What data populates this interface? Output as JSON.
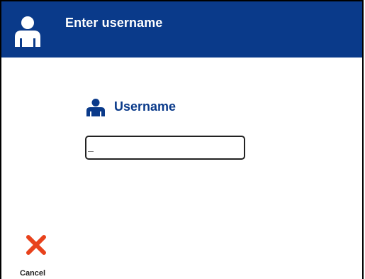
{
  "dialog": {
    "title": "Enter username",
    "title_icon": "user-icon"
  },
  "form": {
    "username_label": "Username",
    "username_label_icon": "user-icon",
    "username_value": "",
    "username_placeholder": ""
  },
  "actions": {
    "cancel_label": "Cancel",
    "cancel_icon": "close-x-icon"
  },
  "colors": {
    "header_bg": "#0a3a8a",
    "accent": "#0a3a8a",
    "cancel": "#e8421c",
    "background": "#ffffff"
  }
}
